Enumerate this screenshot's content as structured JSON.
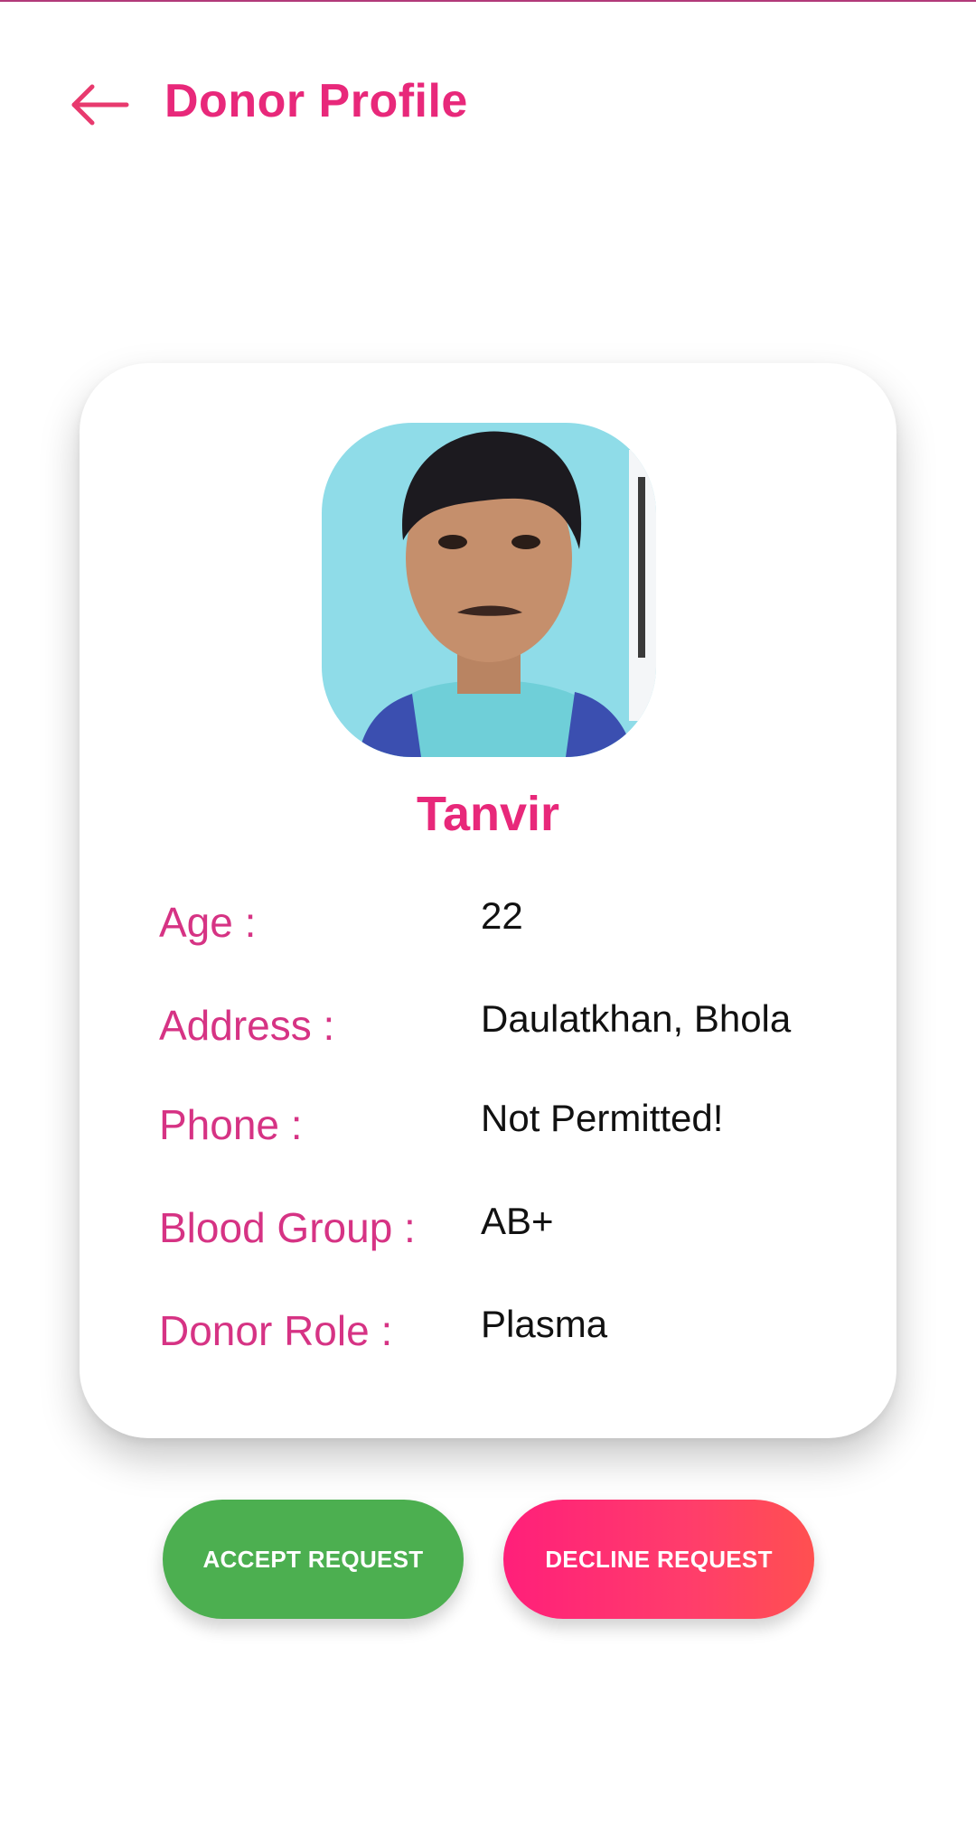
{
  "header": {
    "back_icon": "arrow-left-icon",
    "title": "Donor Profile"
  },
  "colors": {
    "accent": "#e8287a",
    "label": "#d63384",
    "accept": "#4caf50",
    "decline_start": "#ff1f7a",
    "decline_end": "#ff5050"
  },
  "profile": {
    "name": "Tanvir",
    "fields": [
      {
        "label": "Age :",
        "value": "22"
      },
      {
        "label": "Address :",
        "value": "Daulatkhan, Bhola"
      },
      {
        "label": "Phone :",
        "value": "Not Permitted!"
      },
      {
        "label": "Blood Group :",
        "value": "AB+"
      },
      {
        "label": "Donor Role :",
        "value": "Plasma"
      }
    ]
  },
  "actions": {
    "accept_label": "ACCEPT REQUEST",
    "decline_label": "DECLINE REQUEST"
  }
}
